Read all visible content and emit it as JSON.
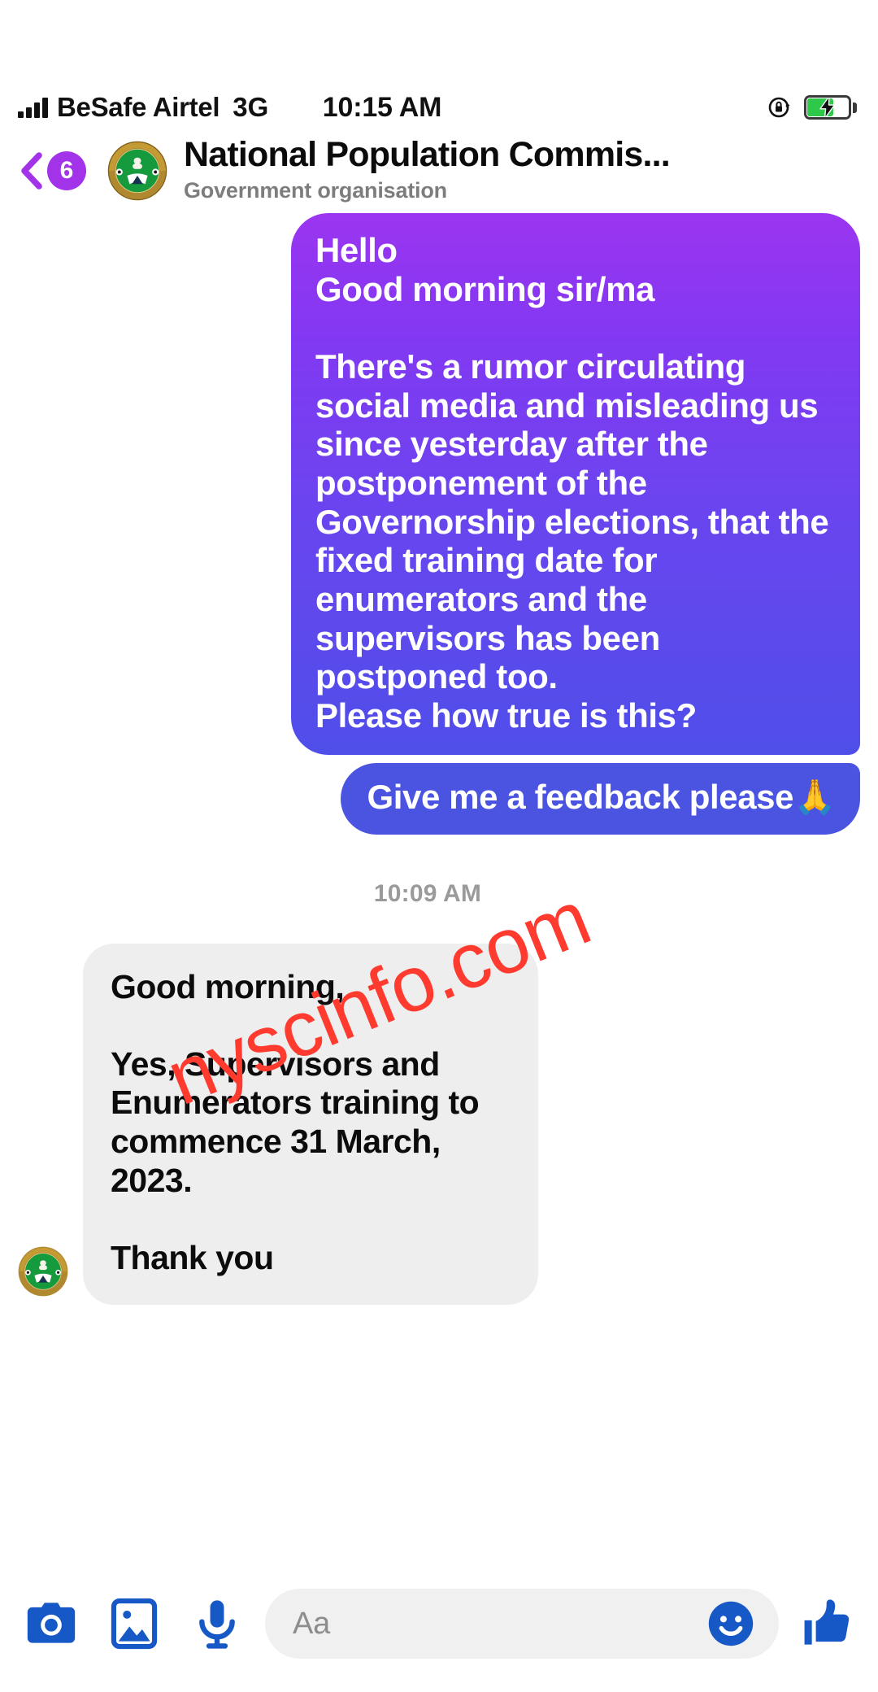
{
  "status_bar": {
    "carrier": "BeSafe Airtel",
    "network_type": "3G",
    "time": "10:15 AM",
    "rotation_lock_icon": "rotation-lock-icon",
    "battery_icon": "battery-charging-icon",
    "signal_icon": "signal-bars-icon"
  },
  "header": {
    "back_icon": "back-chevron-icon",
    "unread_count": "6",
    "avatar_icon": "npc-logo-avatar",
    "title": "National Population Commis...",
    "subtitle": "Government organisation"
  },
  "conversation": {
    "timestamp": "10:09 AM",
    "messages": [
      {
        "id": "msg-outgoing-1",
        "direction": "outgoing",
        "style": "purple-gradient",
        "text": "Hello\nGood morning sir/ma\n\nThere's a rumor circulating social media and misleading us since yesterday after the postponement of the Governorship elections, that the fixed training date for enumerators and the supervisors has been postponed too.\nPlease how true is this?"
      },
      {
        "id": "msg-outgoing-2",
        "direction": "outgoing",
        "style": "blue",
        "text": "Give me a feedback please",
        "emoji": "🙏"
      },
      {
        "id": "msg-incoming-1",
        "direction": "incoming",
        "style": "grey",
        "avatar_icon": "npc-logo-avatar-small",
        "text": "Good morning,\n\nYes, Supervisors and Enumerators training to commence 31 March, 2023.\n\nThank you"
      }
    ]
  },
  "watermark": {
    "text": "nyscinfo.com",
    "color": "#ff3b30"
  },
  "composer": {
    "camera_icon": "camera-icon",
    "gallery_icon": "image-gallery-icon",
    "mic_icon": "microphone-icon",
    "input_placeholder": "Aa",
    "emoji_icon": "smiley-face-icon",
    "thumbs_up_icon": "thumbs-up-icon"
  },
  "colors": {
    "brand_blue": "#1a5fd0",
    "bubble_blue": "#4a54e1",
    "bubble_purple_top": "#9b35f0",
    "bubble_purple_bottom": "#4f4ee9",
    "bubble_grey": "#eeeeee",
    "badge_purple": "#a233e8",
    "battery_green": "#2ec84b",
    "watermark_red": "#ff3b30"
  }
}
